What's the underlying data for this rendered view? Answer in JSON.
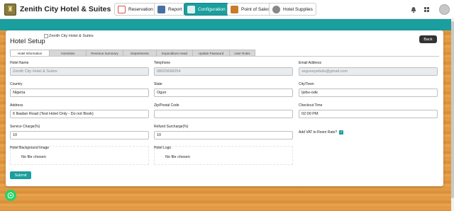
{
  "brand": {
    "name": "Zenith City Hotel & Suites",
    "logo_glyph": "♜"
  },
  "nav": {
    "items": [
      {
        "label": "Reservation",
        "icon": "calendar-icon",
        "color": "#d9534f"
      },
      {
        "label": "Report",
        "icon": "report-icon",
        "color": "#4a6fa5"
      },
      {
        "label": "Configuration",
        "icon": "config-icon",
        "color": "#ffffff",
        "active": true
      },
      {
        "label": "Point of Sales",
        "icon": "pos-icon",
        "color": "#c97a2a"
      },
      {
        "label": "Hotel Supplies",
        "icon": "supplies-icon",
        "color": "#666666"
      }
    ]
  },
  "page": {
    "title": "Hotel Setup",
    "title_image_alt": "Zenith City Hotel & Suites",
    "back_label": "Back",
    "submit_label": "Submit"
  },
  "tabs": [
    {
      "label": "Hotel Information",
      "active": true
    },
    {
      "label": "Amenities"
    },
    {
      "label": "Revenue Summary"
    },
    {
      "label": "Departments"
    },
    {
      "label": "Expenditure Head"
    },
    {
      "label": "Update Password"
    },
    {
      "label": "User Roles"
    }
  ],
  "form": {
    "hotel_name": {
      "label": "Hotel Name",
      "value": "Zenith City Hotel & Suites"
    },
    "telephone": {
      "label": "Telephone",
      "value": "08025668254"
    },
    "email": {
      "label": "Email Address",
      "value": "segunoyebolu@gmail.com"
    },
    "country": {
      "label": "Country",
      "value": "Nigeria"
    },
    "state": {
      "label": "State",
      "value": "Ogun"
    },
    "city": {
      "label": "City/Town",
      "value": "Ijebu-ode"
    },
    "address": {
      "label": "Address",
      "value": "6 Ibadan Road (Test Hotel Only - Do not Book)"
    },
    "zip": {
      "label": "Zip/Postal Code",
      "value": ""
    },
    "checkout": {
      "label": "Checkout Time",
      "value": "02:00 PM"
    },
    "service_charge": {
      "label": "Service Charge(%)",
      "value": "10"
    },
    "refund": {
      "label": "Refund Surcharge(%)",
      "value": "10"
    },
    "vat": {
      "label": "Add VAT to Room Rate?",
      "checked": true
    },
    "bg_image": {
      "label": "Hotel Background Image",
      "file_text": "No file chosen"
    },
    "logo": {
      "label": "Hotel Logo",
      "file_text": "No file chosen"
    }
  },
  "colors": {
    "accent": "#1b9e9e",
    "dark_button": "#333333",
    "whatsapp": "#25d366"
  }
}
